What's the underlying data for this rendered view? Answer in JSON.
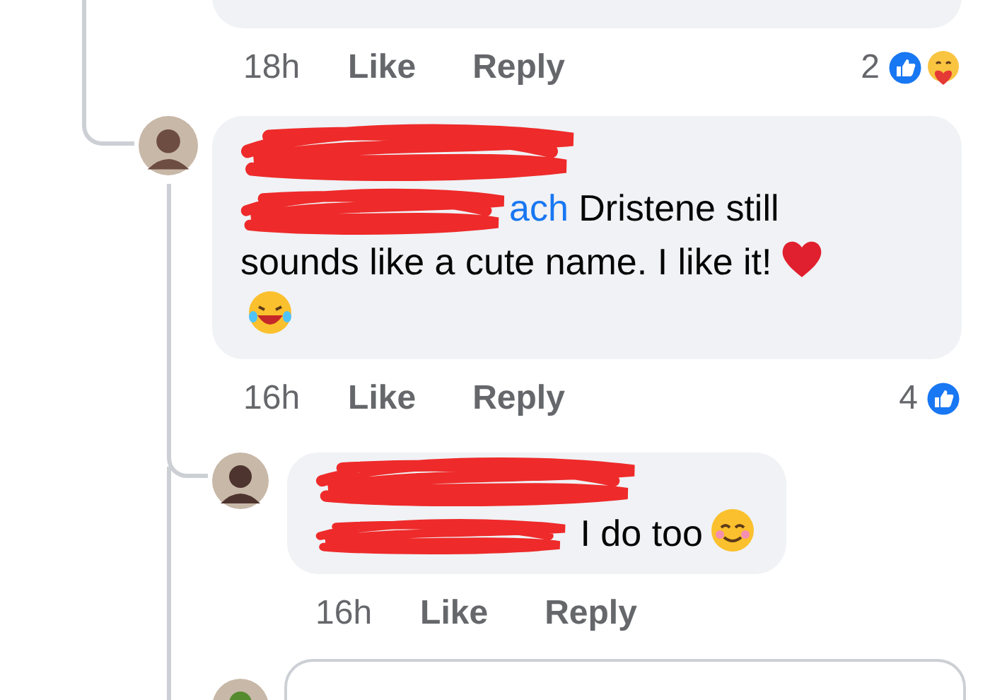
{
  "top_comment": {
    "time": "18h",
    "actions": [
      "Like",
      "Reply"
    ],
    "reaction_count": "2",
    "reactions": [
      {
        "kind": "like"
      },
      {
        "kind": "care"
      }
    ]
  },
  "comment": {
    "mention": "ach",
    "text": "Dristene still sounds like a cute name. I like it!",
    "emojis": [
      {
        "kind": "heart"
      },
      {
        "kind": "laugh"
      }
    ],
    "time": "16h",
    "actions": [
      "Like",
      "Reply"
    ],
    "reaction_count": "4",
    "reactions": [
      {
        "kind": "like"
      }
    ]
  },
  "reply": {
    "text": "I do too",
    "emojis": [
      {
        "kind": "smile"
      }
    ],
    "time": "16h",
    "actions": [
      "Like",
      "Reply"
    ]
  }
}
